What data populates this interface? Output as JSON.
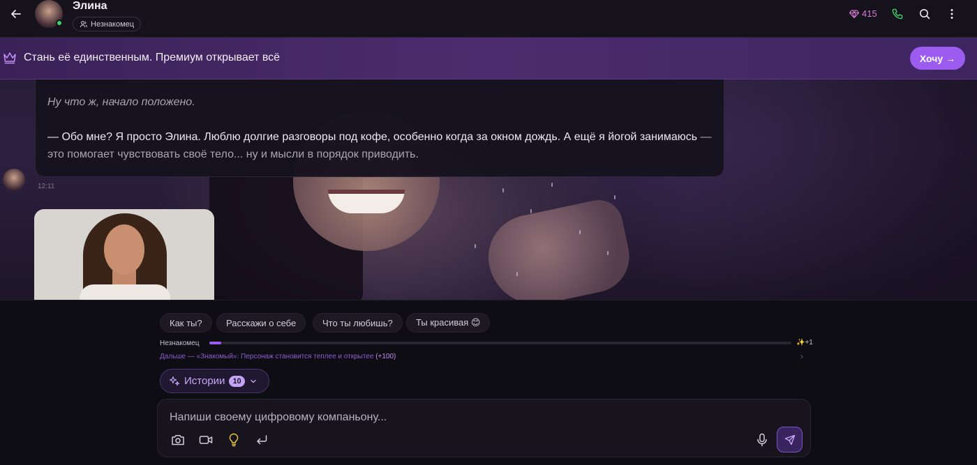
{
  "header": {
    "name": "Элина",
    "relation_status": "Незнакомец",
    "gems": "415",
    "icons": [
      "back-arrow-icon",
      "diamond-icon",
      "phone-icon",
      "search-icon",
      "more-vertical-icon"
    ],
    "gem_color": "#d77ad8",
    "phone_color": "#3ecf6a"
  },
  "banner": {
    "text": "Стань её единственным. Премиум открывает всё",
    "button_label": "Хочу →",
    "accent": "#9c5cf0"
  },
  "message": {
    "italic_line": "Ну что ж, начало положено.",
    "main_text": "— Обо мне? Я просто Элина. Люблю долгие разговоры под кофе, особенно когда за окном дождь. А ещё я йогой занимаюсь",
    "dim_text": " — это помогает чувствовать своё тело... ну и мысли в порядок приводить.",
    "time": "12:11"
  },
  "quick_replies": [
    "Как ты?",
    "Расскажи о себе",
    "Что ты любишь?",
    "Ты красивая 😊"
  ],
  "progress": {
    "level_label": "Незнакомец",
    "fraction": 0.02,
    "plus_label": "✨+1",
    "next_text": "Дальше — «Знакомый»: Персонаж становится теплее и открытее",
    "next_bonus": "(+100)"
  },
  "stories": {
    "label": "Истории",
    "count": "10"
  },
  "composer": {
    "placeholder": "Напиши своему цифровому компаньону...",
    "icons": [
      "camera-icon",
      "video-icon",
      "lightbulb-icon",
      "return-icon",
      "microphone-icon",
      "send-icon"
    ]
  }
}
